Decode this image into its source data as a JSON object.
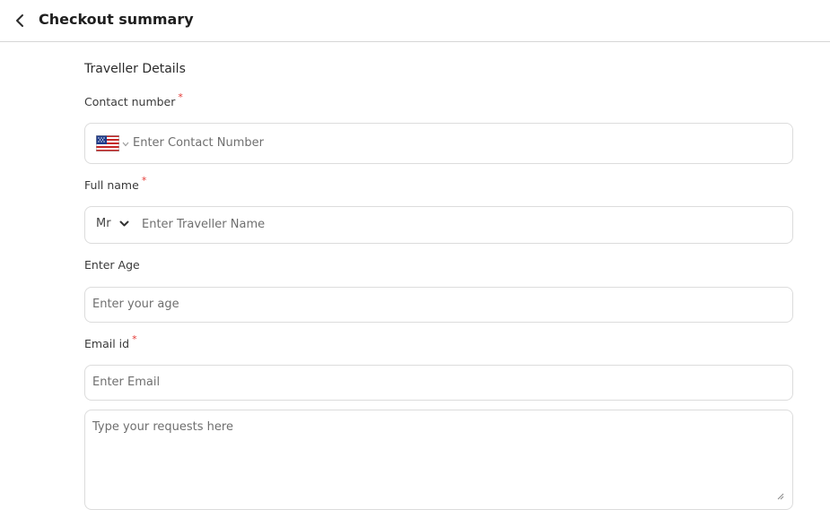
{
  "header": {
    "title": "Checkout summary",
    "back_icon": "chevron-left-icon"
  },
  "form": {
    "section_title": "Traveller Details",
    "contact": {
      "label": "Contact number",
      "required_marker": "*",
      "country_flag": "us-flag-icon",
      "placeholder": "Enter Contact Number"
    },
    "full_name": {
      "label": "Full name",
      "required_marker": "*",
      "title_value": "Mr",
      "placeholder": "Enter Traveller Name"
    },
    "age": {
      "label": "Enter Age",
      "placeholder": "Enter your age"
    },
    "email": {
      "label": "Email id",
      "required_marker": "*",
      "placeholder": "Enter Email"
    },
    "requests": {
      "placeholder": "Type your requests here"
    }
  },
  "colors": {
    "required": "#e53935",
    "border": "#dcdcdc",
    "divider": "#d6d6d6"
  }
}
